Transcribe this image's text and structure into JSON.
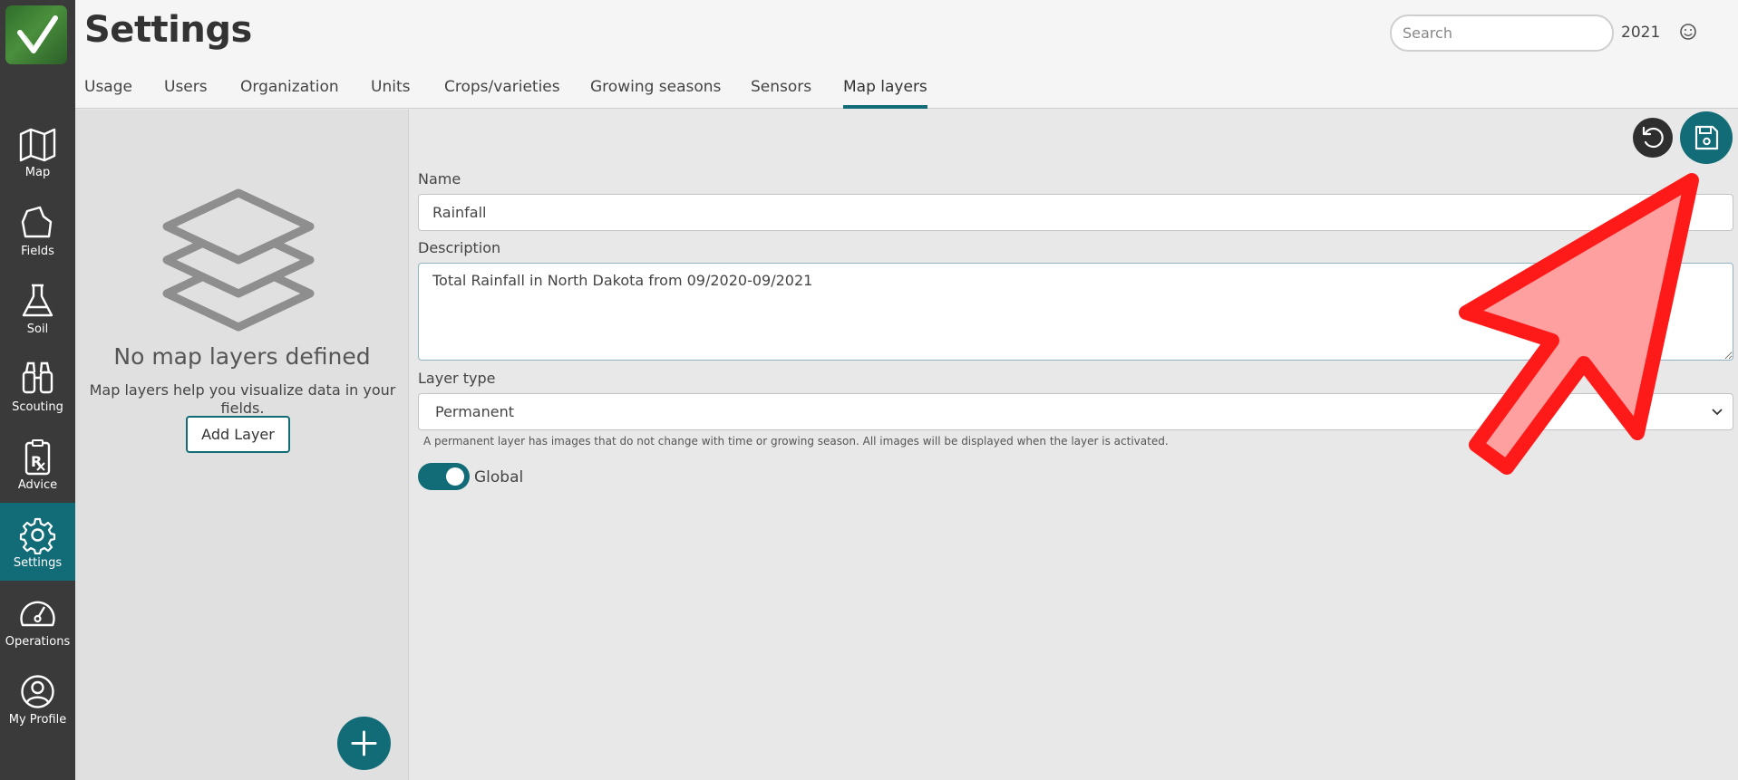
{
  "app": {
    "page_title": "Settings",
    "year": "2021",
    "search": {
      "placeholder": "Search",
      "value": ""
    }
  },
  "nav": {
    "items": [
      {
        "label": "Map",
        "icon": "map-icon"
      },
      {
        "label": "Fields",
        "icon": "field-icon"
      },
      {
        "label": "Soil",
        "icon": "flask-icon"
      },
      {
        "label": "Scouting",
        "icon": "binoculars-icon"
      },
      {
        "label": "Advice",
        "icon": "prescription-icon"
      },
      {
        "label": "Settings",
        "icon": "gear-icon",
        "active": true
      },
      {
        "label": "Operations",
        "icon": "gauge-icon"
      },
      {
        "label": "My Profile",
        "icon": "user-circle-icon"
      }
    ]
  },
  "tabs": [
    {
      "label": "Usage"
    },
    {
      "label": "Users"
    },
    {
      "label": "Organization"
    },
    {
      "label": "Units"
    },
    {
      "label": "Crops/varieties"
    },
    {
      "label": "Growing seasons"
    },
    {
      "label": "Sensors"
    },
    {
      "label": "Map layers",
      "active": true
    }
  ],
  "left_panel": {
    "empty_title": "No map layers defined",
    "empty_description": "Map layers help you visualize data in your fields.",
    "add_layer_label": "Add Layer"
  },
  "form": {
    "name_label": "Name",
    "name_value": "Rainfall",
    "description_label": "Description",
    "description_value": "Total Rainfall in North Dakota from 09/2020-09/2021",
    "layer_type_label": "Layer type",
    "layer_type_value": "Permanent",
    "layer_type_help": "A permanent layer has images that do not change with time or growing season. All images will be displayed when the layer is activated.",
    "global_label": "Global",
    "global_on": true
  },
  "colors": {
    "accent": "#126c78",
    "sidebar": "#3a3a3a",
    "annotation_arrow_fill": "#ffa0a0",
    "annotation_arrow_stroke": "#ff1a1a"
  }
}
